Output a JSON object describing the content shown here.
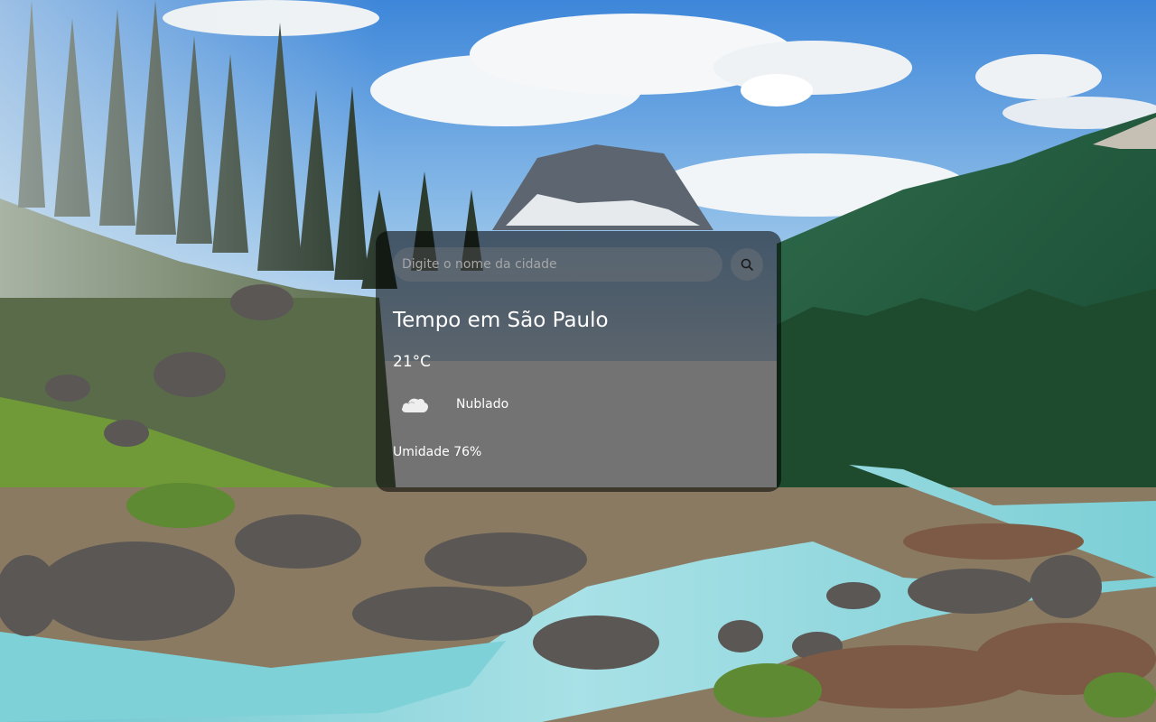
{
  "search": {
    "placeholder": "Digite o nome da cidade",
    "value": "",
    "button_icon": "search-icon"
  },
  "weather": {
    "city_title": "Tempo em São Paulo",
    "temperature": "21°C",
    "condition_icon": "cloud-icon",
    "condition": "Nublado",
    "humidity": "Umidade 76%"
  },
  "colors": {
    "card_background": "rgba(0,0,0,0.55)",
    "input_background": "rgba(124,124,124,0.35)",
    "text": "#ffffff",
    "placeholder": "#a6a6a6"
  }
}
